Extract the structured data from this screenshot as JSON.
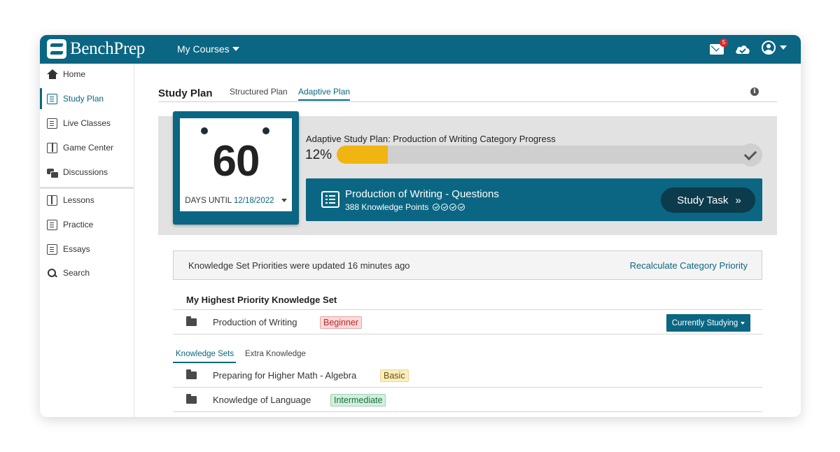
{
  "header": {
    "logo_text": "BenchPrep",
    "courses_label": "My Courses",
    "mail_badge": "5"
  },
  "sidebar": {
    "items": [
      {
        "label": "Home",
        "icon": "home-icon"
      },
      {
        "label": "Study Plan",
        "icon": "study-plan-icon"
      },
      {
        "label": "Live Classes",
        "icon": "live-classes-icon"
      },
      {
        "label": "Game Center",
        "icon": "game-center-icon"
      },
      {
        "label": "Discussions",
        "icon": "discussions-icon"
      },
      {
        "label": "Lessons",
        "icon": "lessons-icon"
      },
      {
        "label": "Practice",
        "icon": "practice-icon"
      },
      {
        "label": "Essays",
        "icon": "essays-icon"
      },
      {
        "label": "Search",
        "icon": "search-icon"
      }
    ],
    "active": "Study Plan"
  },
  "main": {
    "title": "Study Plan",
    "tabs": [
      {
        "label": "Structured Plan"
      },
      {
        "label": "Adaptive Plan"
      }
    ],
    "active_tab": "Adaptive Plan",
    "calendar": {
      "days": "60",
      "until_label": "DAYS UNTIL",
      "date": "12/18/2022"
    },
    "progress": {
      "label": "Adaptive Study Plan: Production of Writing Category Progress",
      "percent_text": "12%",
      "percent": 12
    },
    "task": {
      "title": "Production of Writing - Questions",
      "subtitle": "388 Knowledge Points",
      "button_label": "Study Task",
      "button_glyph": "»"
    },
    "notice": {
      "text": "Knowledge Set Priorities were updated 16 minutes ago",
      "link": "Recalculate Category Priority"
    },
    "highest_priority": {
      "title": "My Highest Priority Knowledge Set",
      "row": {
        "name": "Production of Writing",
        "level": "Beginner",
        "button": "Currently Studying"
      }
    },
    "knowledge_tabs": [
      {
        "label": "Knowledge Sets"
      },
      {
        "label": "Extra Knowledge"
      }
    ],
    "knowledge_sets": [
      {
        "name": "Preparing for Higher Math - Algebra",
        "level": "Basic"
      },
      {
        "name": "Knowledge of Language",
        "level": "Intermediate"
      }
    ]
  },
  "colors": {
    "brand": "#0a6682",
    "progress_fill": "#f1b511",
    "dark_button": "#0c3b4b"
  }
}
